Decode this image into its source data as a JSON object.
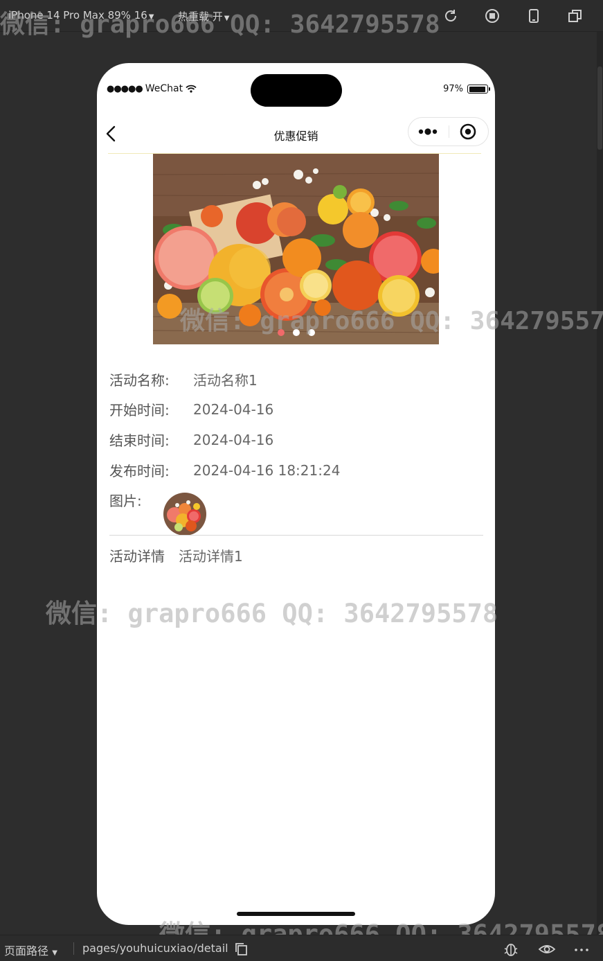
{
  "devtools": {
    "device_label": "iPhone 14 Pro Max 89% 16",
    "hot_reload_label": "热重载 开",
    "page_path_label": "页面路径",
    "page_path": "pages/youhuicuxiao/detail"
  },
  "status_bar": {
    "carrier": "WeChat",
    "battery": "97%"
  },
  "navbar": {
    "title": "优惠促销"
  },
  "carousel": {
    "image": "citrus-fruits-photo",
    "slide_count": 3,
    "active_index": 0,
    "active_color": "#f06a6a"
  },
  "details": {
    "name_label": "活动名称:",
    "name_value": "活动名称1",
    "start_label": "开始时间:",
    "start_value": "2024-04-16",
    "end_label": "结束时间:",
    "end_value": "2024-04-16",
    "publish_label": "发布时间:",
    "publish_value": "2024-04-16 18:21:24",
    "image_label": "图片:",
    "desc_label": "活动详情",
    "desc_value": "活动详情1"
  },
  "watermark": {
    "text_1": "微信: grapro666 QQ: 3642795578",
    "text_2": "微信: grapro666 QQ: 3642795578",
    "text_3": "微信: grapro666 QQ: 3642795578"
  }
}
